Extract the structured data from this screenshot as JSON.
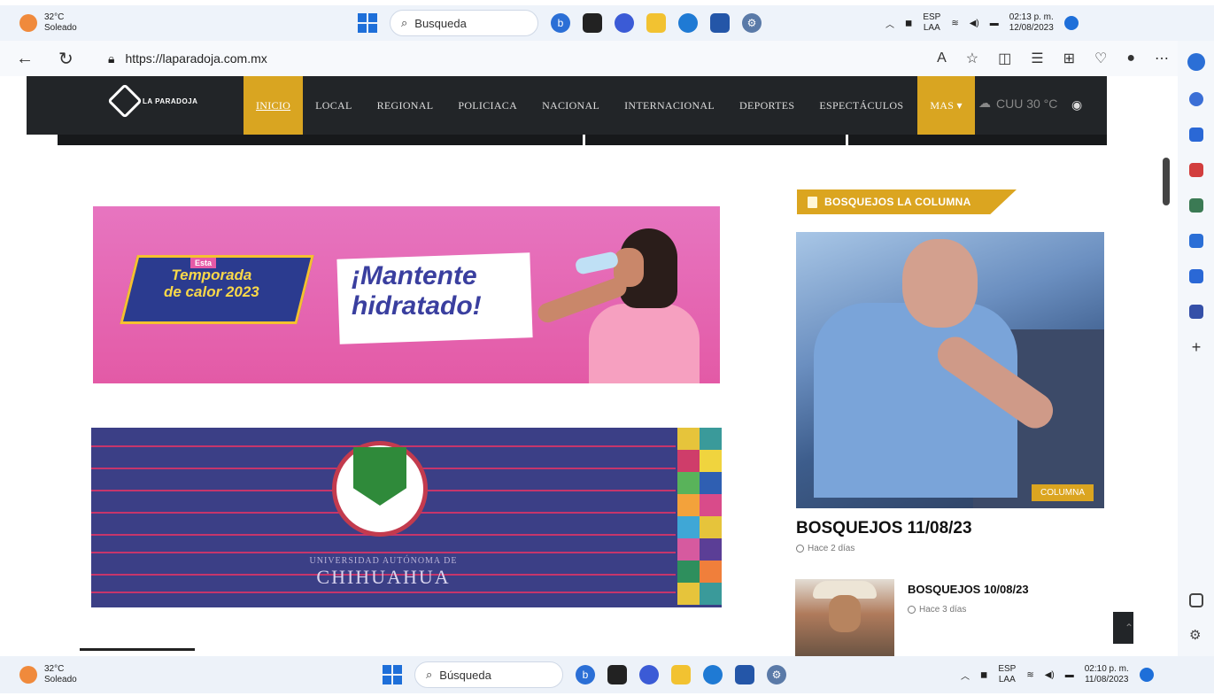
{
  "taskbar_top": {
    "temperature": "32°C",
    "condition": "Soleado",
    "search_placeholder": "Busqueda",
    "lang1": "ESP",
    "lang2": "LAA",
    "time": "02:13 p. m.",
    "date": "12/08/2023"
  },
  "taskbar_bottom": {
    "temperature": "32°C",
    "condition": "Soleado",
    "search_placeholder": "Búsqueda",
    "lang1": "ESP",
    "lang2": "LAA",
    "time": "02:10 p. m.",
    "date": "11/08/2023"
  },
  "browser": {
    "url": "https://laparadoja.com.mx"
  },
  "site": {
    "logo_text": "LA PARADOJA",
    "menu": [
      {
        "label": "INICIO",
        "active": true
      },
      {
        "label": "LOCAL"
      },
      {
        "label": "REGIONAL"
      },
      {
        "label": "POLICIACA"
      },
      {
        "label": "NACIONAL"
      },
      {
        "label": "INTERNACIONAL"
      },
      {
        "label": "DEPORTES"
      },
      {
        "label": "ESPECTÁCULOS"
      },
      {
        "label": "MAS ▾"
      }
    ],
    "weather_temp": "CUU 30 °C",
    "banner1": {
      "badge_top": "Esta",
      "badge_line1": "Temporada",
      "badge_line2": "de calor 2023",
      "message_line1": "¡Mantente",
      "message_line2": "hidratado!"
    },
    "banner2": {
      "name_small": "UNIVERSIDAD AUTÓNOMA DE",
      "name_big": "CHIHUAHUA"
    },
    "sidebar": {
      "section_title": "BOSQUEJOS LA COLUMNA",
      "feature_tag": "COLUMNA",
      "feature_title": "BOSQUEJOS 11/08/23",
      "feature_time": "Hace 2 días",
      "second_title": "BOSQUEJOS 10/08/23",
      "second_time": "Hace 3 días"
    }
  },
  "colors": {
    "accent": "#d9a521",
    "nav_bg": "#222528",
    "banner_pink": "#e35aa6",
    "banner_navy": "#3b3f86"
  }
}
